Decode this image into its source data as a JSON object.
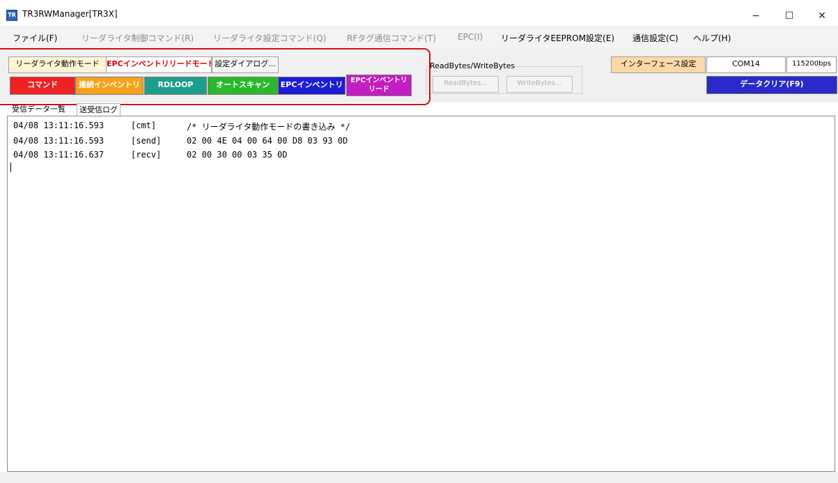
{
  "window": {
    "title": "TR3RWManager[TR3X]",
    "icon": "TR",
    "controls": [
      "−",
      "☐",
      "✕"
    ]
  },
  "menu": [
    {
      "label": "ファイル(F)",
      "enabled": true
    },
    {
      "label": "リーダライタ制御コマンド(R)",
      "enabled": false
    },
    {
      "label": "リーダライタ設定コマンド(Q)",
      "enabled": false
    },
    {
      "label": "RFタグ通信コマンド(T)",
      "enabled": false
    },
    {
      "label": "EPC(I)",
      "enabled": false
    },
    {
      "label": "リーダライタEEPROM設定(E)",
      "enabled": true
    },
    {
      "label": "通信設定(C)",
      "enabled": true
    },
    {
      "label": "ヘルプ(H)",
      "enabled": true
    }
  ],
  "toolbar": {
    "mode_buttons": [
      {
        "label": "リーダライタ動作モード",
        "active": false
      },
      {
        "label": "EPCインベントリリードモード",
        "active": true
      },
      {
        "label": "設定ダイアログ...",
        "active": false
      }
    ],
    "command_buttons": [
      {
        "label": "コマンド",
        "color": "#ee2222"
      },
      {
        "label": "連続インベントリ",
        "color": "#f7a21b"
      },
      {
        "label": "RDLOOP",
        "color": "#1e9e8c"
      },
      {
        "label": "オートスキャン",
        "color": "#2cb82c"
      },
      {
        "label": "EPCインベントリ",
        "color": "#1d1dd6"
      },
      {
        "label": "EPCインベントリ リード",
        "color": "#c21ec2"
      }
    ],
    "rw_group": {
      "label": "ReadBytes/WriteBytes",
      "read_label": "ReadBytes...",
      "write_label": "WriteBytes..."
    },
    "interface_button": "インターフェース設定",
    "port": "COM14",
    "baud": "115200bps",
    "clear_button": "データクリア(F9)"
  },
  "colors": {
    "annotation": "#d41010",
    "interface_bg": "#fcd9a8",
    "clear_bg": "#2a2acb"
  },
  "tabs": [
    {
      "label": "受信データ一覧",
      "active": false
    },
    {
      "label": "送受信ログ",
      "active": true
    }
  ],
  "log": [
    {
      "time": "04/08 13:11:16.593",
      "kind": "[cmt]",
      "text": "/* リーダライタ動作モードの書き込み */"
    },
    {
      "time": "04/08 13:11:16.593",
      "kind": "[send]",
      "text": "02 00 4E 04 00 64 00 D8 03 93 0D"
    },
    {
      "time": "04/08 13:11:16.637",
      "kind": "[recv]",
      "text": "02 00 30 00 03 35 0D"
    }
  ]
}
